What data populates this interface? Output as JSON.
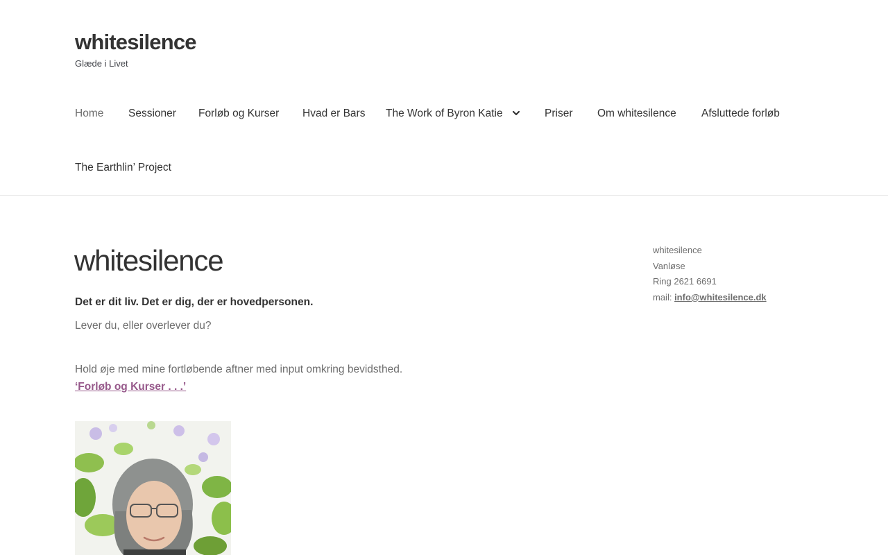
{
  "site": {
    "title": "whitesilence",
    "tagline": "Glæde i Livet"
  },
  "nav": {
    "items": [
      {
        "label": "Home"
      },
      {
        "label": "Sessioner"
      },
      {
        "label": "Forløb og Kurser"
      },
      {
        "label": "Hvad er Bars"
      },
      {
        "label": "The Work of Byron Katie"
      },
      {
        "label": "Priser"
      },
      {
        "label": "Om whitesilence"
      },
      {
        "label": "Afsluttede forløb"
      },
      {
        "label": "The Earthlin’ Project"
      }
    ],
    "dropdown_icon": "chevron-down-icon"
  },
  "main": {
    "title": "whitesilence",
    "lead": "Det er dit liv. Det er dig, der er hovedpersonen.",
    "question": "Lever du, eller overlever du?",
    "info": "Hold øje med mine fortløbende aftner med input omkring bevidsthed.",
    "link_text": "‘Forløb og Kurser . . .’"
  },
  "sidebar": {
    "name": "whitesilence",
    "location": "Vanløse",
    "phone": "Ring 2621 6691",
    "mail_label": "mail: ",
    "mail": "info@whitesilence.dk"
  },
  "colors": {
    "text": "#333333",
    "muted": "#6d6d6d",
    "link": "#96588a"
  }
}
